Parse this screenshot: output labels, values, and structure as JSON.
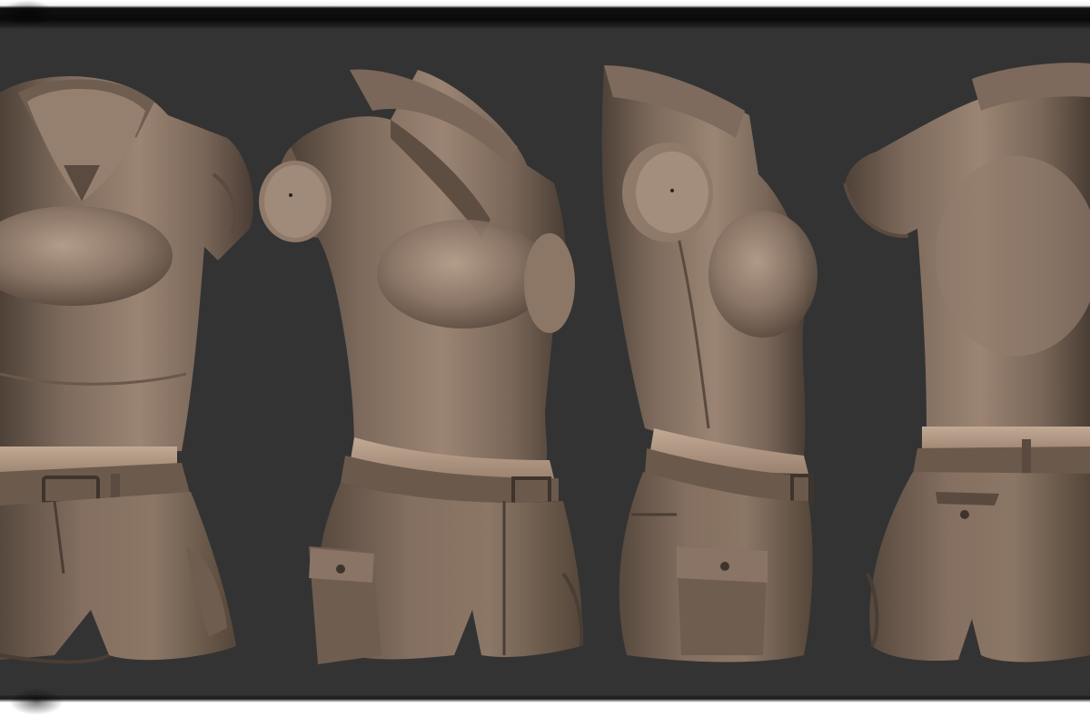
{
  "scene": {
    "description_kind": "sculpt-turnaround",
    "views": [
      {
        "id": "front",
        "label": ""
      },
      {
        "id": "three-quarter",
        "label": ""
      },
      {
        "id": "side",
        "label": ""
      },
      {
        "id": "back",
        "label": ""
      }
    ],
    "colors": {
      "background": "#333333",
      "clay": "#8a7667",
      "clay_light": "#b29a88",
      "clay_dark": "#4e4137",
      "skin_band": "#b59c87",
      "frame_dark": "#0f0f0f",
      "frame_light": "#ffffff"
    }
  }
}
